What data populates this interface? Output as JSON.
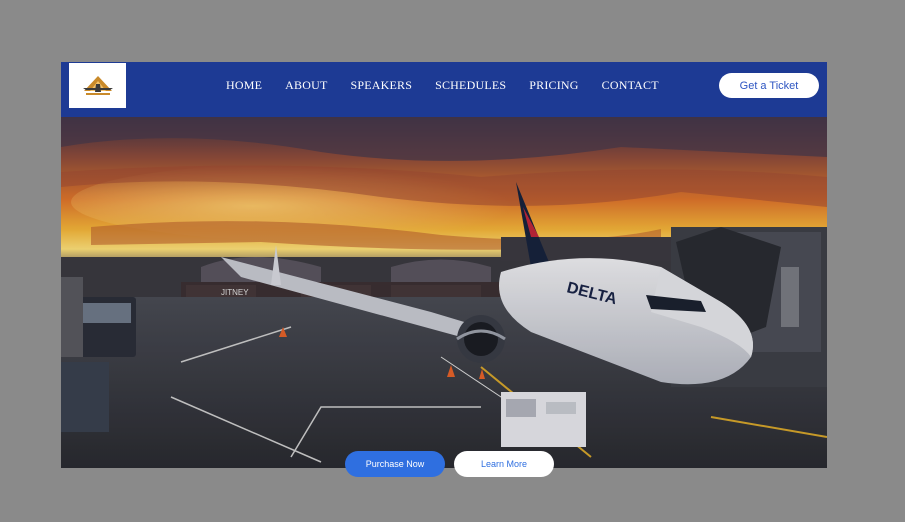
{
  "header": {
    "logo_icon": "airplane-logo-icon",
    "nav": {
      "home": "HOME",
      "about": "ABOUT",
      "speakers": "SPEAKERS",
      "schedules": "SCHEDULES",
      "pricing": "PRICING",
      "contact": "CONTACT"
    },
    "cta_label": "Get a Ticket"
  },
  "hero": {
    "image": "airplane-at-gate-sunset",
    "plane_livery": "DELTA",
    "bus_livery": "JITNEY",
    "buttons": {
      "purchase_label": "Purchase Now",
      "learn_label": "Learn More"
    }
  },
  "colors": {
    "nav_background": "#1d3a94",
    "accent": "#2f6fe0",
    "page_background": "#8a8a8a"
  }
}
